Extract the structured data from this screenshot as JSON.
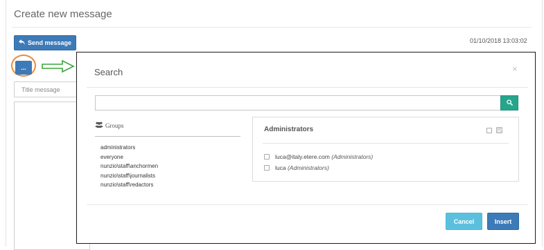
{
  "page": {
    "title": "Create new message",
    "send_button_label": "Send message",
    "timestamp": "01/10/2018 13:03:02",
    "dots_button_label": "...",
    "title_placeholder": "Title message",
    "accent_color": "#3d7ab8",
    "highlight_color": "#e98b3a",
    "arrow_color": "#3aa53a"
  },
  "modal": {
    "title": "Search",
    "close_label": "×",
    "search_value": "",
    "groups_label": "Groups",
    "groups": [
      "administrators",
      "everyone",
      "nunzio\\staff\\anchormen",
      "nunzio\\staff\\journalists",
      "nunzio\\staff\\redactors"
    ],
    "selected_group": {
      "title": "Administrators",
      "select_all_checked": false,
      "select_all_alt_checked": true,
      "members": [
        {
          "name": "luca@italy.etere.com",
          "group": "(Administrators)",
          "checked": false
        },
        {
          "name": "luca",
          "group": "(Administrators)",
          "checked": false
        }
      ]
    },
    "cancel_label": "Cancel",
    "insert_label": "Insert",
    "cancel_color": "#5bc0de",
    "search_button_color": "#26a58c"
  }
}
